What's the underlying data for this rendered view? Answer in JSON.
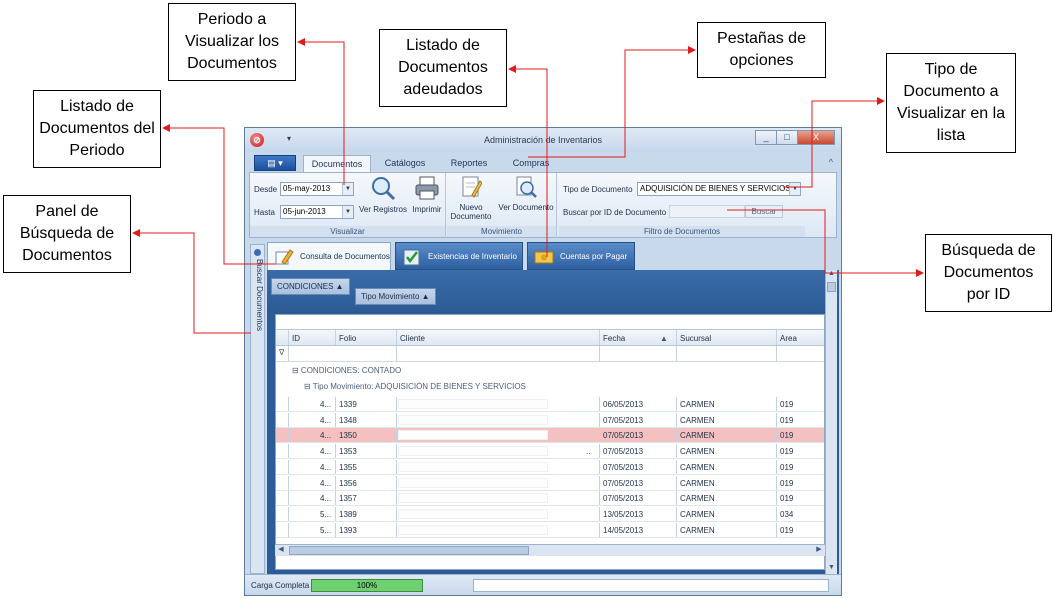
{
  "callouts": {
    "periodo": "Periodo a Visualizar los Documentos",
    "listado_adeudados": "Listado de Documentos adeudados",
    "pestanas": "Pestañas de opciones",
    "tipo_doc": "Tipo de Documento a Visualizar en la lista",
    "listado_periodo": "Listado de Documentos del Periodo",
    "panel_busqueda": "Panel de Búsqueda de Documentos",
    "busqueda_id": "Búsqueda de Documentos por ID"
  },
  "window": {
    "title": "Administración de Inventarios",
    "qat": "▾",
    "buttons": {
      "minimize": "_",
      "maximize": "□",
      "close": "X"
    }
  },
  "ribbon_tabs": {
    "file": "▤ ▾",
    "tabs": [
      "Documentos",
      "Catálogos",
      "Reportes",
      "Compras"
    ],
    "collapse": "^"
  },
  "ribbon": {
    "visualizar": {
      "desde_label": "Desde",
      "desde_value": "05-may-2013",
      "hasta_label": "Hasta",
      "hasta_value": "05-jun-2013",
      "ver_registros": "Ver Registros",
      "imprimir": "Imprimir",
      "group_label": "Visualizar"
    },
    "movimiento": {
      "nuevo_doc_line1": "Nuevo",
      "nuevo_doc_line2": "Documento",
      "ver_documento": "Ver Documento",
      "group_label": "Movimiento"
    },
    "filtro": {
      "tipo_label": "Tipo de Documento",
      "tipo_value": "ADQUISICIÓN DE BIENES Y SERVICIOS",
      "buscar_label": "Buscar por ID de Documento",
      "buscar_value": "",
      "buscar_button": "Buscar",
      "group_label": "Filtro de Documentos"
    }
  },
  "side_panel": {
    "label": "Buscar Documentos"
  },
  "doc_tabs": [
    "Consulta de Documentos",
    "Existencias de Inventario",
    "Cuentas por Pagar"
  ],
  "group_chips": [
    "CONDICIONES ▲",
    "Tipo Movimiento ▲"
  ],
  "grid": {
    "columns": [
      "ID",
      "Folio",
      "Cliente",
      "Fecha",
      "Sucursal",
      "Area"
    ],
    "fecha_sort": "▲",
    "group1": "⊟ CONDICIONES: CONTADO",
    "group2": "⊟ Tipo Movimiento: ADQUISICIÓN DE BIENES Y SERVICIOS",
    "rows": [
      {
        "id": "4...",
        "folio": "1339",
        "cliente": "",
        "fecha": "06/05/2013",
        "sucursal": "CARMEN",
        "area": "019"
      },
      {
        "id": "4...",
        "folio": "1348",
        "cliente": "",
        "fecha": "07/05/2013",
        "sucursal": "CARMEN",
        "area": "019"
      },
      {
        "id": "4...",
        "folio": "1350",
        "cliente": "",
        "fecha": "07/05/2013",
        "sucursal": "CARMEN",
        "area": "019"
      },
      {
        "id": "4...",
        "folio": "1353",
        "cliente": "..",
        "fecha": "07/05/2013",
        "sucursal": "CARMEN",
        "area": "019"
      },
      {
        "id": "4...",
        "folio": "1355",
        "cliente": "",
        "fecha": "07/05/2013",
        "sucursal": "CARMEN",
        "area": "019"
      },
      {
        "id": "4...",
        "folio": "1356",
        "cliente": "",
        "fecha": "07/05/2013",
        "sucursal": "CARMEN",
        "area": "019"
      },
      {
        "id": "4...",
        "folio": "1357",
        "cliente": "",
        "fecha": "07/05/2013",
        "sucursal": "CARMEN",
        "area": "019"
      },
      {
        "id": "5...",
        "folio": "1389",
        "cliente": "",
        "fecha": "13/05/2013",
        "sucursal": "CARMEN",
        "area": "034"
      },
      {
        "id": "5...",
        "folio": "1393",
        "cliente": "",
        "fecha": "14/05/2013",
        "sucursal": "CARMEN",
        "area": "019"
      }
    ]
  },
  "status": {
    "text": "Carga Completa",
    "progress": "100%",
    "progress_fraction": 1.0
  },
  "colors": {
    "callout_arrow": "#e01b1b",
    "selected_row": "#f4c0c0",
    "progress": "#6fd06f"
  }
}
